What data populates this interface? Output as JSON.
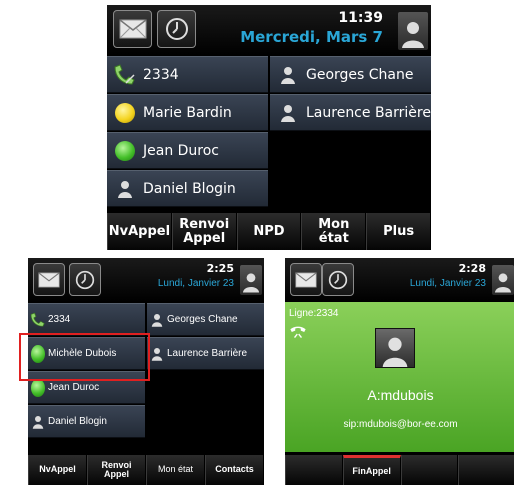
{
  "screen1": {
    "time": "11:39",
    "date": "Mercredi, Mars 7",
    "line_keys": [
      {
        "label": "2334"
      },
      {
        "label": "Marie Bardin"
      },
      {
        "label": "Jean Duroc"
      },
      {
        "label": "Daniel Blogin"
      },
      {
        "label": "Georges Chane"
      },
      {
        "label": "Laurence Barrière"
      }
    ],
    "soft_keys": [
      {
        "label": "NvAppel"
      },
      {
        "label": "Renvoi\nAppel"
      },
      {
        "label": "NPD"
      },
      {
        "label": "Mon état"
      },
      {
        "label": "Plus"
      }
    ]
  },
  "screen2": {
    "time": "2:25",
    "date": "Lundi, Janvier 23",
    "line_keys": [
      {
        "label": "2334"
      },
      {
        "label": "Michèle Dubois"
      },
      {
        "label": "Jean Duroc"
      },
      {
        "label": "Daniel Blogin"
      },
      {
        "label": "Georges Chane"
      },
      {
        "label": "Laurence Barrière"
      }
    ],
    "soft_keys": [
      {
        "label": "NvAppel"
      },
      {
        "label": "Renvoi\nAppel"
      },
      {
        "label": "Mon état"
      },
      {
        "label": "Contacts"
      }
    ]
  },
  "screen3": {
    "time": "2:28",
    "date": "Lundi, Janvier 23",
    "line": "Ligne:2334",
    "callee": "A:mdubois",
    "uri": "sip:mdubois@bor-ee.com",
    "soft_keys": [
      {
        "label": ""
      },
      {
        "label": "FinAppel"
      },
      {
        "label": ""
      },
      {
        "label": ""
      }
    ]
  },
  "icons": {
    "messages": "envelope-icon",
    "recents": "clock-icon",
    "registered_line": "handset-icon",
    "contact": "person-icon",
    "presence_available": "green-status-icon",
    "presence_away": "yellow-status-icon"
  },
  "colors": {
    "date_blue": "#2aa6d6",
    "call_green": "#5bb82f",
    "highlight_red": "#e02020"
  }
}
